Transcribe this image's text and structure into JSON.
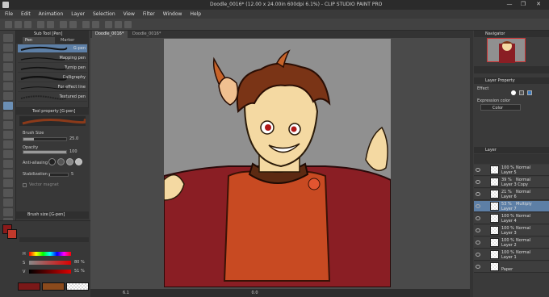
{
  "app": {
    "title": "Doodle_0016* (12.00 x 24.00in 600dpi 6.1%) - CLIP STUDIO PAINT PRO",
    "window_buttons": [
      "—",
      "❐",
      "✕"
    ]
  },
  "menu": [
    "File",
    "Edit",
    "Animation",
    "Layer",
    "Selection",
    "View",
    "Filter",
    "Window",
    "Help"
  ],
  "doc_tabs": [
    "Doodle_0016*",
    "Doodle_0016*"
  ],
  "subtool": {
    "panel_title": "Sub Tool [Pen]",
    "tabs": [
      "Pen",
      "Marker"
    ],
    "brushes": [
      "G-pen",
      "Mapping pen",
      "Turnip pen",
      "Calligraphy",
      "For effect line",
      "Textured pen"
    ],
    "selected_index": 0
  },
  "tool_property": {
    "title": "Tool property [G-pen]",
    "brush_name": "G-pen",
    "brush_size_label": "Brush Size",
    "brush_size_value": "25.0",
    "opacity_label": "Opacity",
    "opacity_value": "100",
    "antialias_label": "Anti-aliasing",
    "stabilization_label": "Stabilization",
    "stabilization_value": "5",
    "vector_magnet_label": "Vector magnet"
  },
  "brush_size_panel": {
    "title": "Brush size [G-pen]"
  },
  "color": {
    "main": "#8b1a1a",
    "sub": "#c0392b",
    "h_label": "H",
    "s_label": "S",
    "v_label": "V",
    "s_value": "80 %",
    "v_value": "51 %",
    "history": [
      "#7a1818",
      "#8b4a1c",
      "#ffffff"
    ]
  },
  "status": {
    "zoom": "6.1",
    "angle": "0.0"
  },
  "navigator": {
    "title": "Navigator"
  },
  "layer_property": {
    "title": "Layer Property",
    "effect_label": "Effect",
    "expression_color_label": "Expression color",
    "expression_color_value": "Color"
  },
  "layer_panel": {
    "title": "Layer",
    "layers": [
      {
        "opacity": "100 %",
        "blend": "Normal",
        "name": "Layer 5"
      },
      {
        "opacity": "39 %",
        "blend": "Normal",
        "name": "Layer 3 Copy"
      },
      {
        "opacity": "21 %",
        "blend": "Normal",
        "name": "Layer 6"
      },
      {
        "opacity": "53 %",
        "blend": "Multiply",
        "name": "Layer 7"
      },
      {
        "opacity": "100 %",
        "blend": "Normal",
        "name": "Layer 4"
      },
      {
        "opacity": "100 %",
        "blend": "Normal",
        "name": "Layer 3"
      },
      {
        "opacity": "100 %",
        "blend": "Normal",
        "name": "Layer 2"
      },
      {
        "opacity": "100 %",
        "blend": "Normal",
        "name": "Layer 1"
      },
      {
        "opacity": "",
        "blend": "",
        "name": "Paper"
      }
    ],
    "selected_index": 3
  },
  "icons": [
    "pen-tool-icon",
    "eraser-icon",
    "eyedropper-icon",
    "fill-icon",
    "text-icon",
    "eye-icon",
    "layer-thumbnail"
  ]
}
